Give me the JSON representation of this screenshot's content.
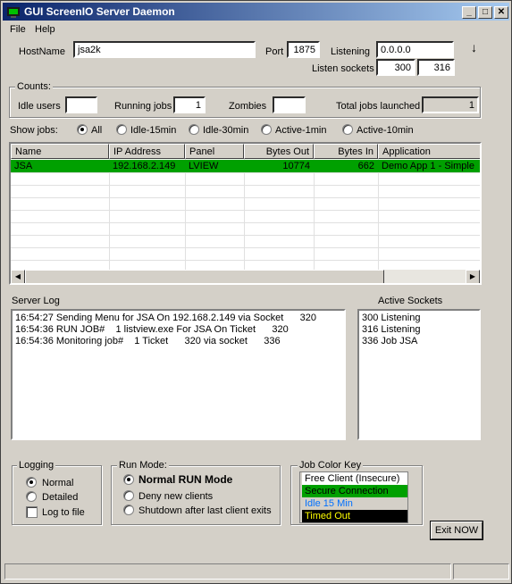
{
  "window": {
    "title": "GUI ScreenIO Server Daemon",
    "minimize_glyph": "_",
    "maximize_glyph": "□",
    "close_glyph": "✕"
  },
  "menu": {
    "file": "File",
    "help": "Help"
  },
  "server": {
    "hostname_label": "HostName",
    "hostname_value": "jsa2k",
    "port_label": "Port",
    "port_value": "1875",
    "listening_label": "Listening",
    "listening_value": "0.0.0.0",
    "arrow_glyph": "↓",
    "listen_sockets_label": "Listen sockets",
    "listen_socket_1": "300",
    "listen_socket_2": "316"
  },
  "counts": {
    "title": "Counts:",
    "idle_users_label": "Idle users",
    "idle_users_value": "",
    "running_jobs_label": "Running jobs",
    "running_jobs_value": "1",
    "zombies_label": "Zombies",
    "zombies_value": "",
    "total_jobs_label": "Total jobs launched",
    "total_jobs_value": "1"
  },
  "show_jobs": {
    "label": "Show jobs:",
    "options": [
      "All",
      "Idle-15min",
      "Idle-30min",
      "Active-1min",
      "Active-10min"
    ],
    "selected": "All"
  },
  "jobs_table": {
    "columns": [
      "Name",
      "IP Address",
      "Panel",
      "Bytes Out",
      "Bytes In",
      "Application"
    ],
    "rows": [
      [
        "JSA",
        "192.168.2.149",
        "LVIEW",
        "10774",
        "662",
        "Demo App 1 - Simple"
      ]
    ],
    "row_color": "#00a000"
  },
  "server_log": {
    "title": "Server Log",
    "lines": [
      "16:54:27 Sending Menu for JSA On 192.168.2.149 via Socket      320",
      "16:54:36 RUN JOB#    1 listview.exe For JSA On Ticket      320",
      "16:54:36 Monitoring job#    1 Ticket      320 via socket      336"
    ]
  },
  "active_sockets": {
    "title": "Active Sockets",
    "lines": [
      "300 Listening",
      "316 Listening",
      "336 Job JSA"
    ]
  },
  "logging": {
    "title": "Logging",
    "normal": "Normal",
    "detailed": "Detailed",
    "log_to_file": "Log to file",
    "selected": "Normal"
  },
  "run_mode": {
    "title": "Run Mode:",
    "normal": "Normal RUN Mode",
    "deny": "Deny new clients",
    "shutdown": "Shutdown after last client exits",
    "selected": "Normal RUN Mode"
  },
  "color_key": {
    "title": "Job Color Key",
    "items": [
      {
        "label": "Free Client (Insecure)",
        "bg": "#ffffff",
        "fg": "#000000"
      },
      {
        "label": "Secure Connection",
        "bg": "#00a000",
        "fg": "#000000"
      },
      {
        "label": "Idle 15 Min",
        "bg": "#d4d0c8",
        "fg": "#0070ff"
      },
      {
        "label": "Timed Out",
        "bg": "#000000",
        "fg": "#ffff00"
      }
    ]
  },
  "exit_button": "Exit NOW"
}
